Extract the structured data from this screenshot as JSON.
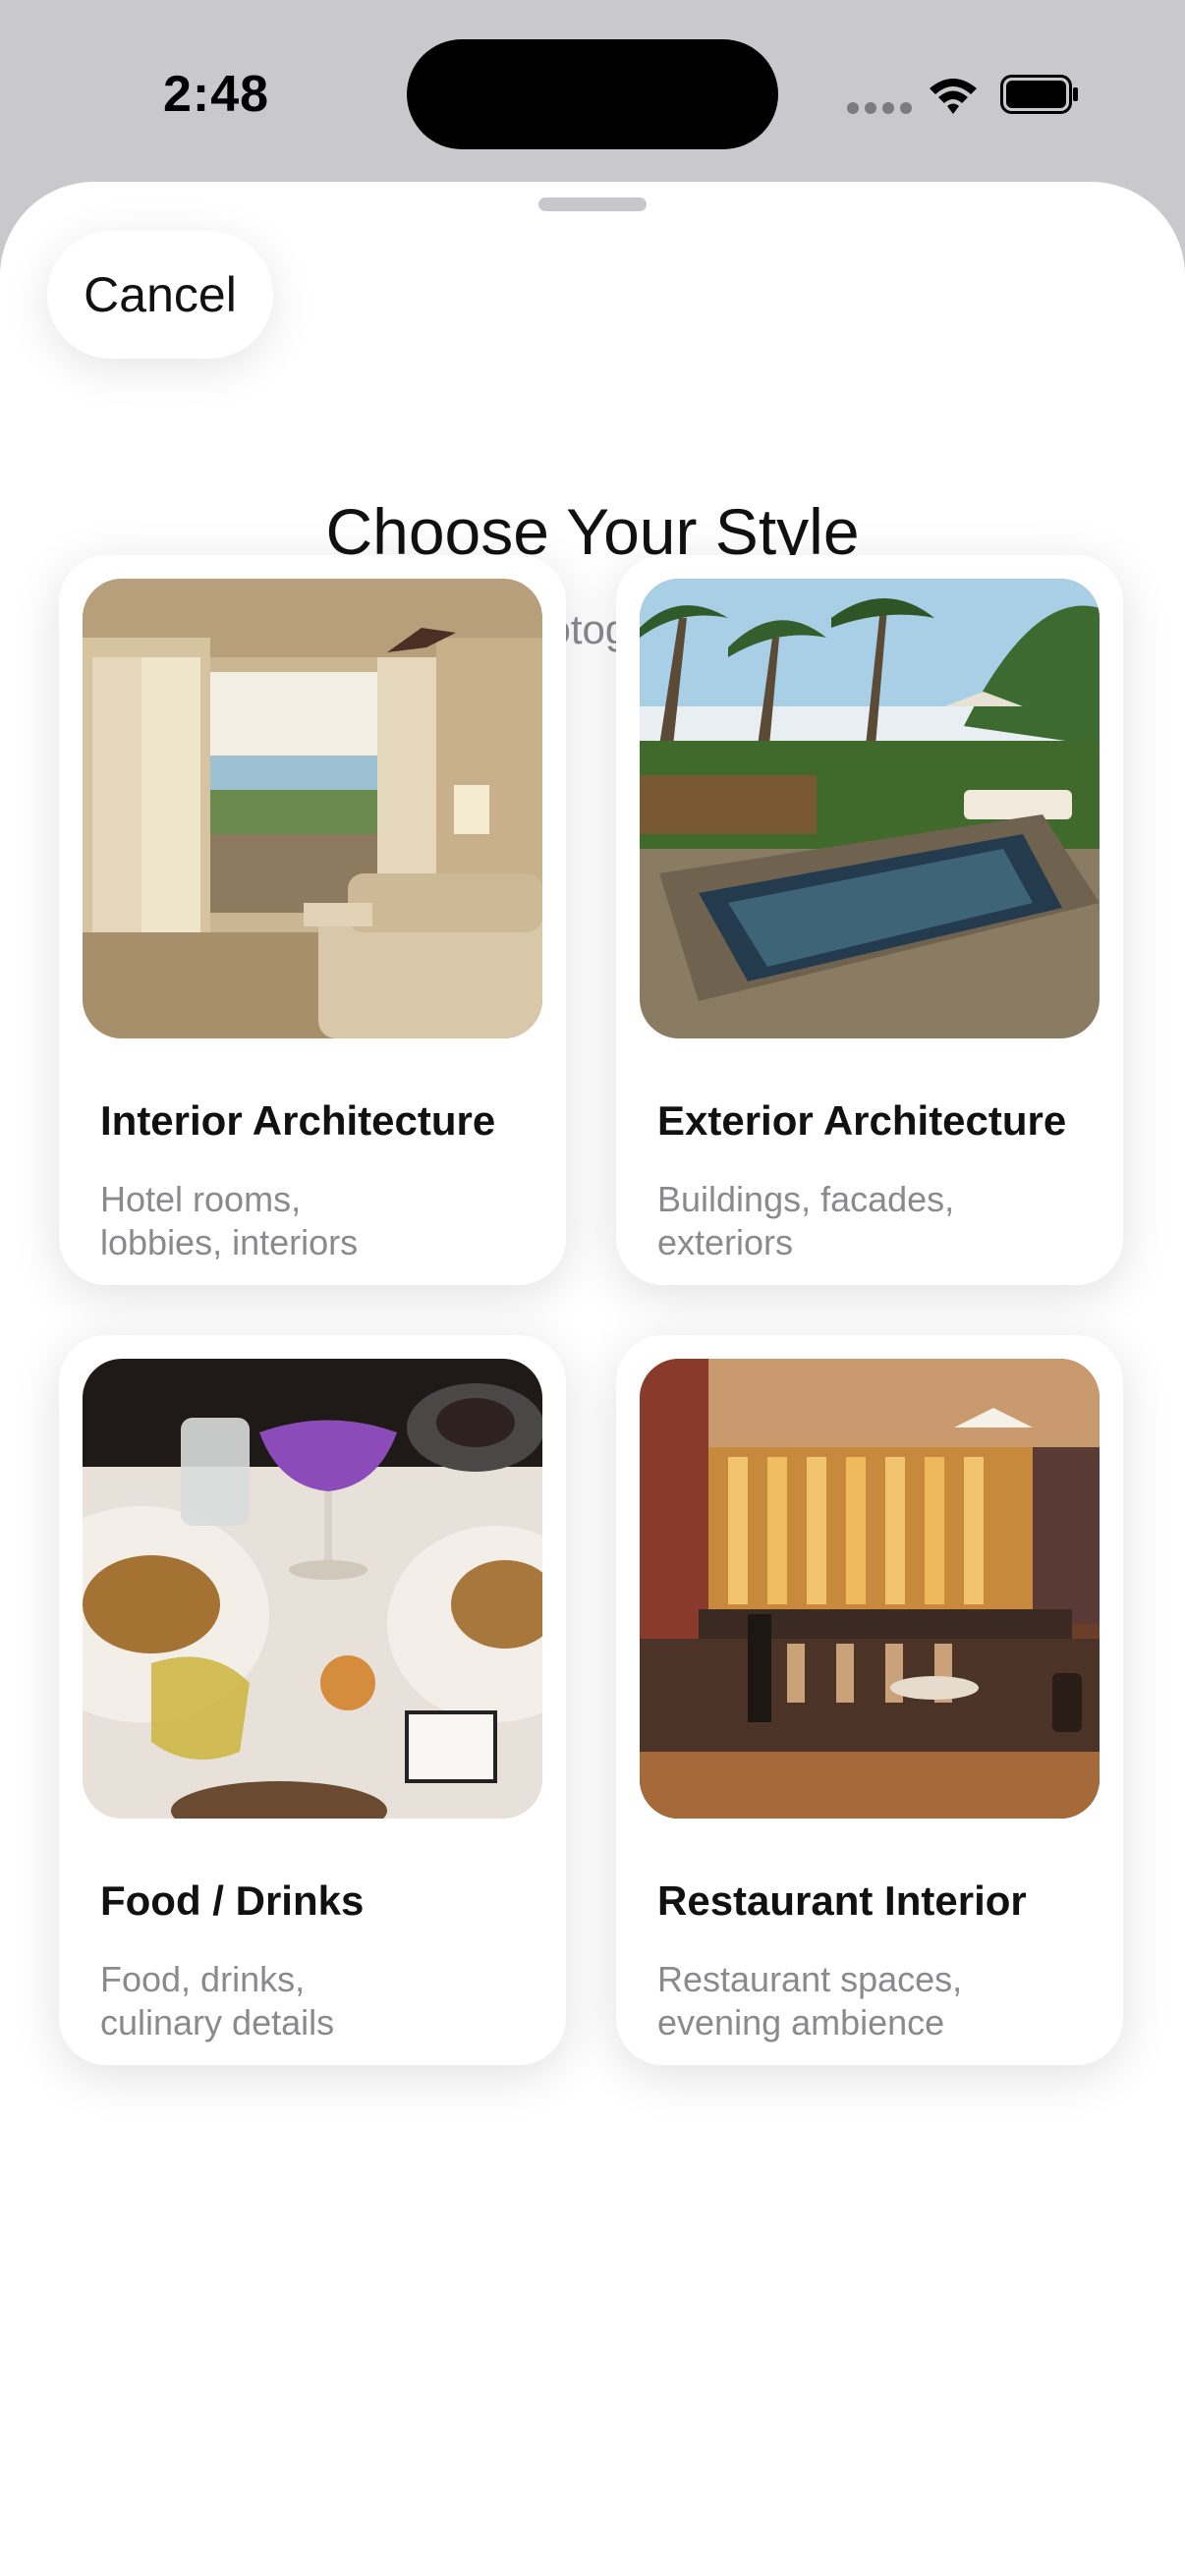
{
  "status_bar": {
    "time": "2:48"
  },
  "sheet": {
    "cancel_label": "Cancel",
    "title": "Choose Your Style",
    "subtitle": "Select the type of photography for best results"
  },
  "styles": [
    {
      "title": "Interior Architecture",
      "description": "Hotel rooms,\nlobbies, interiors"
    },
    {
      "title": "Exterior Architecture",
      "description": "Buildings, facades,\nexteriors"
    },
    {
      "title": "Food / Drinks",
      "description": "Food, drinks,\nculinary details"
    },
    {
      "title": "Restaurant Interior",
      "description": "Restaurant spaces,\nevening ambience"
    }
  ]
}
